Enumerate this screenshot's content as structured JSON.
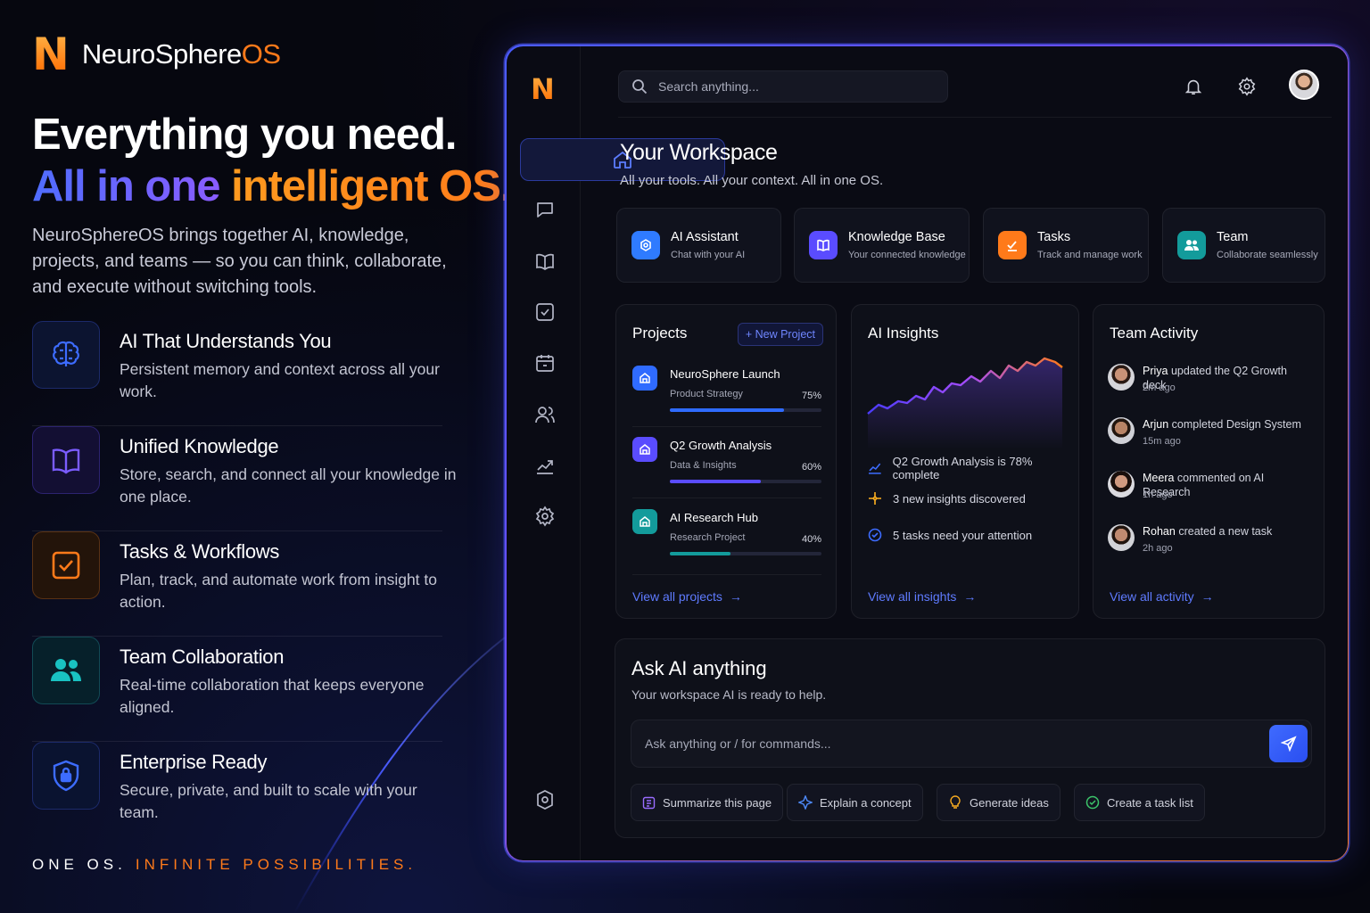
{
  "brand": {
    "name_main": "NeuroSphere",
    "name_os": "OS",
    "logo_letter": "N"
  },
  "hero": {
    "line1": "Everything you need.",
    "line2a": "All in one",
    "line2b": "intelligent OS.",
    "intro": "NeuroSphereOS brings together AI, knowledge, projects, and teams — so you can think, collaborate, and execute without switching tools."
  },
  "features": [
    {
      "title": "AI That Understands You",
      "desc": "Persistent memory and context across all your work.",
      "icon": "brain-icon",
      "color": "#3d6cff"
    },
    {
      "title": "Unified Knowledge",
      "desc": "Store, search, and connect all your knowledge in one place.",
      "icon": "book-icon",
      "color": "#7a5cff"
    },
    {
      "title": "Tasks & Workflows",
      "desc": "Plan, track, and automate work from insight to action.",
      "icon": "checkbox-icon",
      "color": "#ff7a1a"
    },
    {
      "title": "Team Collaboration",
      "desc": "Real-time collaboration that keeps everyone aligned.",
      "icon": "team-icon",
      "color": "#19c2c2"
    },
    {
      "title": "Enterprise Ready",
      "desc": "Secure, private, and built to scale with your team.",
      "icon": "shield-lock-icon",
      "color": "#3d6cff"
    }
  ],
  "tagline": {
    "a": "ONE OS.",
    "b": "INFINITE POSSIBILITIES."
  },
  "app": {
    "search_placeholder": "Search anything...",
    "workspace_title": "Your Workspace",
    "workspace_sub": "All your tools. All your context. All in one OS.",
    "quick": [
      {
        "title": "AI Assistant",
        "sub": "Chat with your AI",
        "color": "#2f7bff",
        "icon": "ai-assistant-icon"
      },
      {
        "title": "Knowledge Base",
        "sub": "Your connected knowledge",
        "color": "#5a4cff",
        "icon": "book-icon"
      },
      {
        "title": "Tasks",
        "sub": "Track and manage work",
        "color": "#ff7a1a",
        "icon": "tasks-icon"
      },
      {
        "title": "Team",
        "sub": "Collaborate seamlessly",
        "color": "#139b9b",
        "icon": "team-icon"
      }
    ],
    "projects": {
      "title": "Projects",
      "new_label": "+ New Project",
      "items": [
        {
          "name": "NeuroSphere Launch",
          "sub": "Product Strategy",
          "pct": "75%",
          "progress": 0.75,
          "color": "#2f6bff"
        },
        {
          "name": "Q2 Growth Analysis",
          "sub": "Data & Insights",
          "pct": "60%",
          "progress": 0.6,
          "color": "#5a4cff"
        },
        {
          "name": "AI Research Hub",
          "sub": "Research Project",
          "pct": "40%",
          "progress": 0.4,
          "color": "#139b9b"
        }
      ],
      "link": "View all projects"
    },
    "insights": {
      "title": "AI Insights",
      "items": [
        {
          "text": "Q2 Growth Analysis is 78% complete",
          "icon": "trend-icon"
        },
        {
          "text": "3 new insights discovered",
          "icon": "sparkle-icon"
        },
        {
          "text": "5 tasks need your attention",
          "icon": "check-circle-icon"
        }
      ],
      "link": "View all insights"
    },
    "activity": {
      "title": "Team Activity",
      "items": [
        {
          "name": "Priya",
          "action": "updated the Q2 Growth deck",
          "time": "2m ago"
        },
        {
          "name": "Arjun",
          "action": "completed Design System",
          "time": "15m ago"
        },
        {
          "name": "Meera",
          "action": "commented on AI Research",
          "time": "1h ago"
        },
        {
          "name": "Rohan",
          "action": "created a new task",
          "time": "2h ago"
        }
      ],
      "link": "View all activity"
    },
    "ask": {
      "title": "Ask AI anything",
      "sub": "Your workspace AI is ready to help.",
      "placeholder": "Ask anything or / for commands...",
      "chips": [
        "Summarize this page",
        "Explain a concept",
        "Generate ideas",
        "Create a task list"
      ]
    }
  }
}
